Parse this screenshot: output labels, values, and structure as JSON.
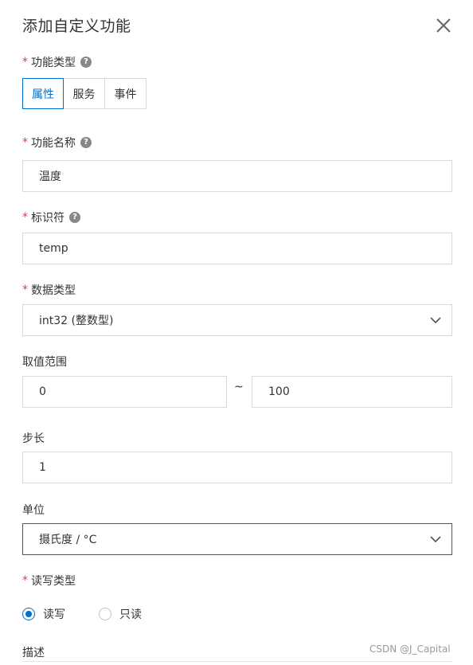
{
  "dialog": {
    "title": "添加自定义功能",
    "close_icon": "close-icon"
  },
  "function_type": {
    "label": "功能类型",
    "required_mark": "*",
    "help_icon": "?",
    "options": [
      "属性",
      "服务",
      "事件"
    ],
    "selected": "属性"
  },
  "function_name": {
    "label": "功能名称",
    "required_mark": "*",
    "help_icon": "?",
    "value": "温度"
  },
  "identifier": {
    "label": "标识符",
    "required_mark": "*",
    "help_icon": "?",
    "value": "temp"
  },
  "data_type": {
    "label": "数据类型",
    "required_mark": "*",
    "value": "int32 (整数型)",
    "icon": "chevron-down-icon"
  },
  "value_range": {
    "label": "取值范围",
    "min": "0",
    "separator": "~",
    "max": "100"
  },
  "step": {
    "label": "步长",
    "value": "1"
  },
  "unit": {
    "label": "单位",
    "value": "摄氏度 / °C",
    "icon": "chevron-down-icon"
  },
  "rw_type": {
    "label": "读写类型",
    "required_mark": "*",
    "options": [
      "读写",
      "只读"
    ],
    "selected": "读写"
  },
  "description": {
    "label": "描述"
  },
  "watermark": "CSDN @J_Capital",
  "colors": {
    "accent": "#0070cc",
    "required": "#e4393c",
    "border": "#d9d9d9",
    "help_icon_bg": "#888888"
  }
}
